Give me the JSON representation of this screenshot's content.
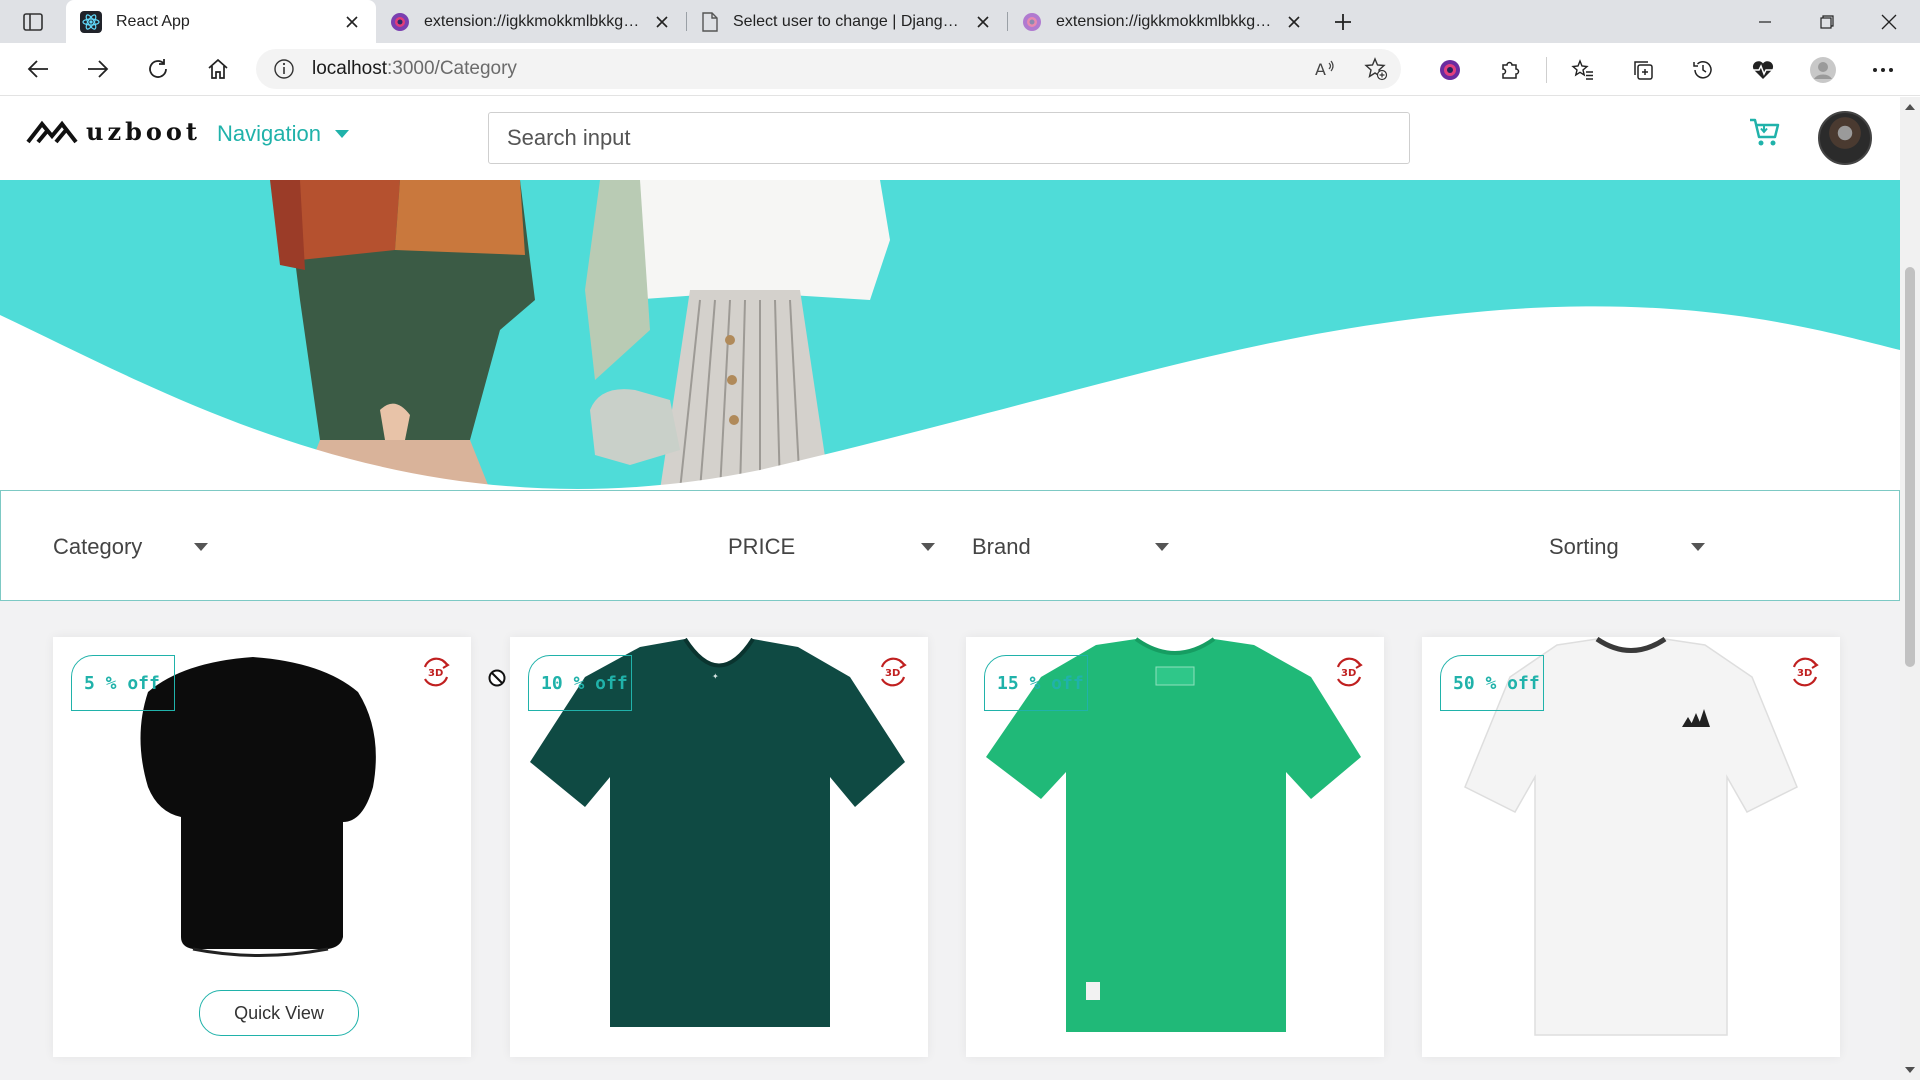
{
  "browser": {
    "tabs": [
      {
        "title": "React App",
        "active": true,
        "icon": "react-icon"
      },
      {
        "title": "extension://igkkmokkmlbkkgdnk",
        "active": false,
        "icon": "extension-icon"
      },
      {
        "title": "Select user to change | Django si",
        "active": false,
        "icon": "page-icon"
      },
      {
        "title": "extension://igkkmokkmlbkkgdnk",
        "active": false,
        "icon": "extension-icon"
      }
    ],
    "address": {
      "host": "localhost",
      "path": ":3000/Category"
    }
  },
  "navbar": {
    "logo_text": "uzboot",
    "nav_label": "Navigation",
    "search_placeholder": "Search input"
  },
  "filters": {
    "category": "Category",
    "price": "PRICE",
    "brand": "Brand",
    "sorting": "Sorting"
  },
  "products": [
    {
      "discount": "5 % off",
      "color": "#0c0c0c",
      "quick_view": "Quick View"
    },
    {
      "discount": "10 % off",
      "color": "#0f4a43"
    },
    {
      "discount": "15 % off",
      "color": "#20b978"
    },
    {
      "discount": "50 % off",
      "color": "#f4f4f4"
    }
  ],
  "colors": {
    "accent": "#20b2aa",
    "hero": "#4fdcd8"
  }
}
